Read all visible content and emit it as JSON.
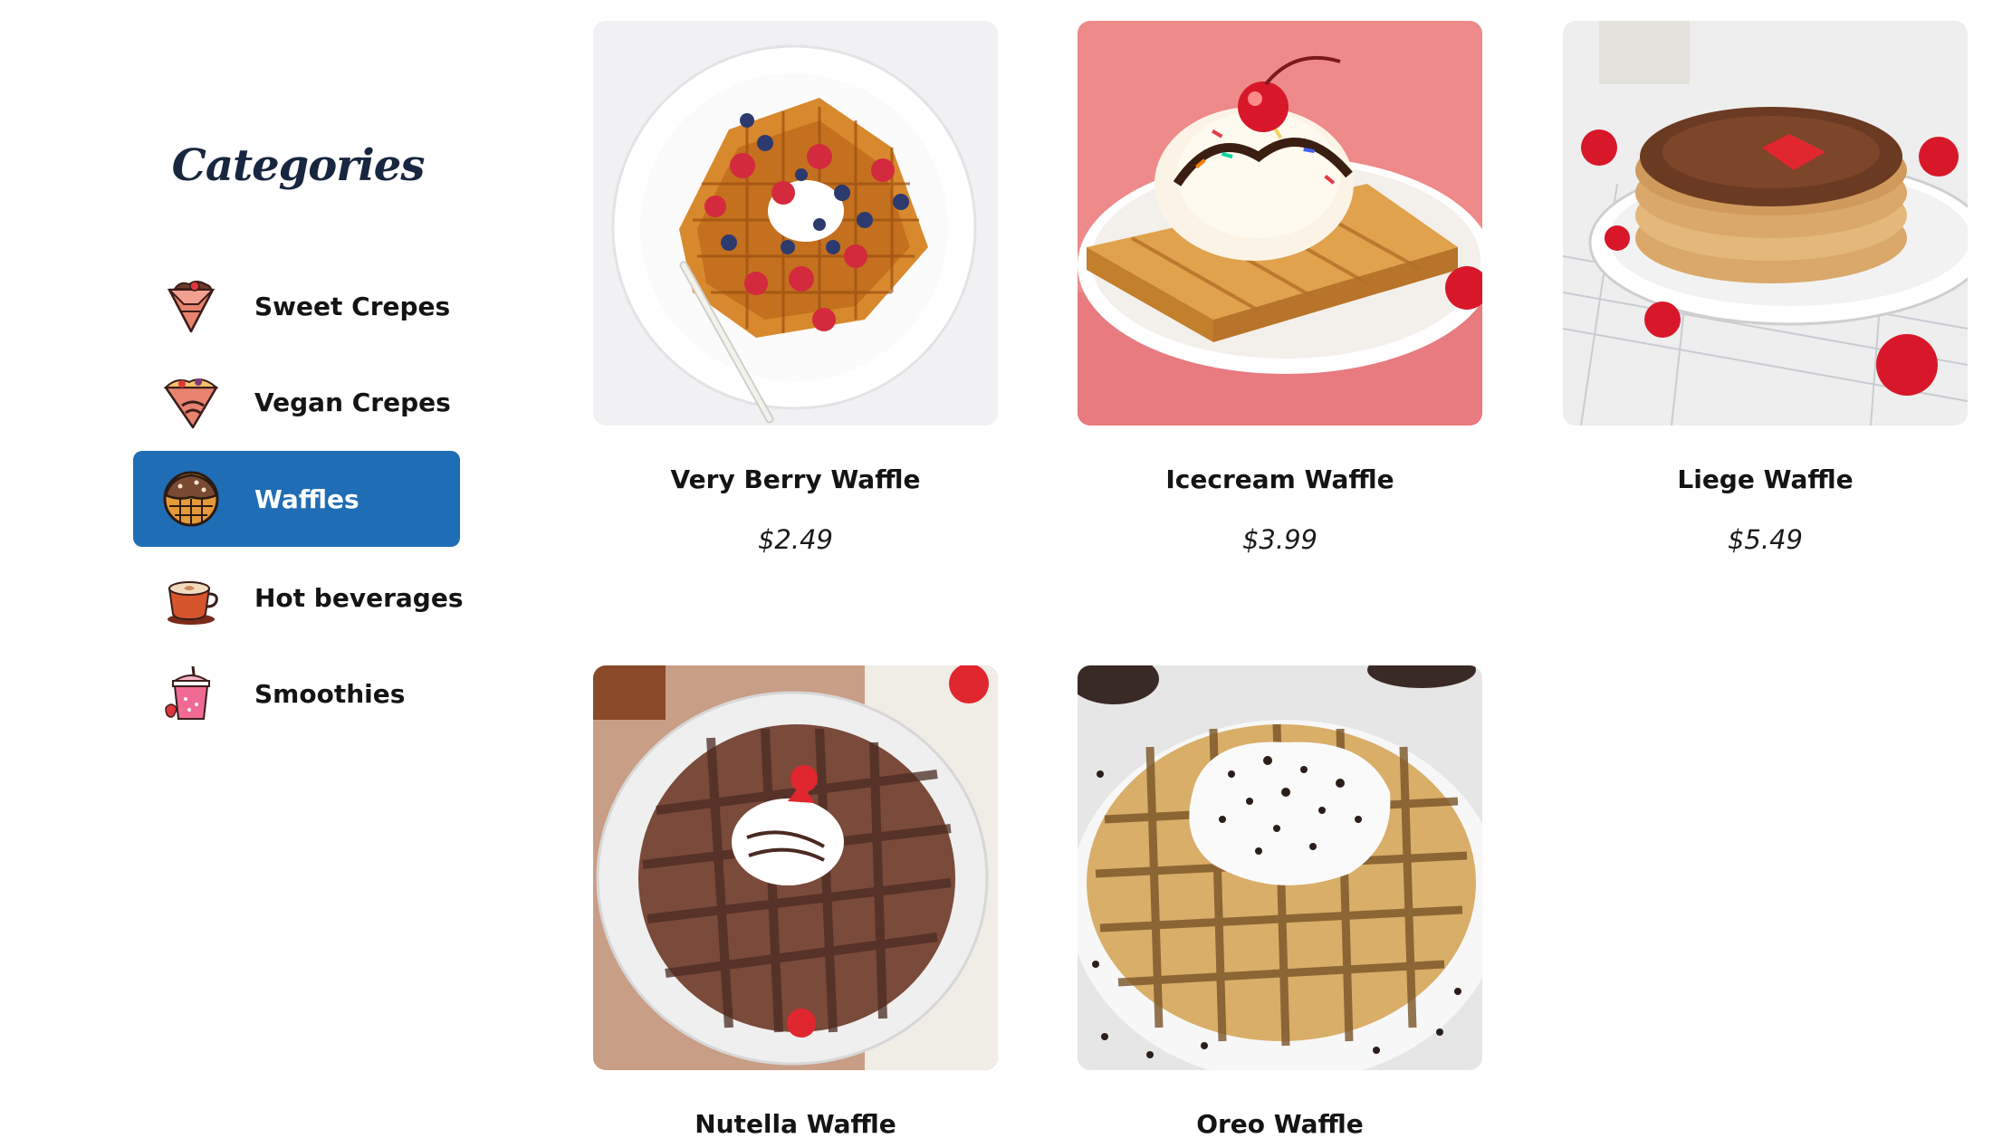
{
  "sidebar": {
    "title": "Categories",
    "items": [
      {
        "label": "Sweet Crepes",
        "icon": "sweet-crepe-icon"
      },
      {
        "label": "Vegan Crepes",
        "icon": "vegan-crepe-icon"
      },
      {
        "label": "Waffles",
        "icon": "waffle-icon",
        "active": true
      },
      {
        "label": "Hot beverages",
        "icon": "coffee-cup-icon"
      },
      {
        "label": "Smoothies",
        "icon": "smoothie-icon"
      }
    ]
  },
  "products": [
    {
      "name": "Very Berry Waffle",
      "price": "$2.49",
      "image": "berry-waffle-image"
    },
    {
      "name": "Icecream Waffle",
      "price": "$3.99",
      "image": "icecream-waffle-image"
    },
    {
      "name": "Liege Waffle",
      "price": "$5.49",
      "image": "liege-waffle-image"
    },
    {
      "name": "Nutella Waffle",
      "image": "nutella-waffle-image"
    },
    {
      "name": "Oreo Waffle",
      "image": "oreo-waffle-image"
    }
  ],
  "colors": {
    "accent": "#1f6db5",
    "title": "#18263f",
    "text": "#141414"
  }
}
